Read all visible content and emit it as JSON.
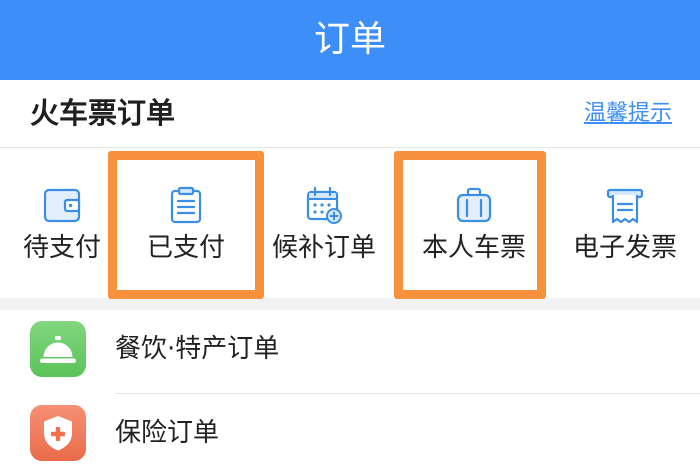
{
  "header": {
    "title": "订单"
  },
  "section": {
    "title": "火车票订单",
    "tips_link": "温馨提示"
  },
  "order_tabs": [
    {
      "label": "待支付",
      "icon": "wallet-icon",
      "highlighted": false
    },
    {
      "label": "已支付",
      "icon": "clipboard-icon",
      "highlighted": true
    },
    {
      "label": "候补订单",
      "icon": "calendar-plus-icon",
      "highlighted": false
    },
    {
      "label": "本人车票",
      "icon": "suitcase-icon",
      "highlighted": true
    },
    {
      "label": "电子发票",
      "icon": "receipt-icon",
      "highlighted": false
    }
  ],
  "other_orders": [
    {
      "label": "餐饮·特产订单",
      "icon": "service-bell-icon",
      "icon_color": "#5fcb5b"
    },
    {
      "label": "保险订单",
      "icon": "shield-plus-icon",
      "icon_color": "#f3704d"
    }
  ],
  "colors": {
    "primary": "#3d8ef7",
    "highlight": "#f8913b",
    "icon_line": "#3a8ee6"
  }
}
